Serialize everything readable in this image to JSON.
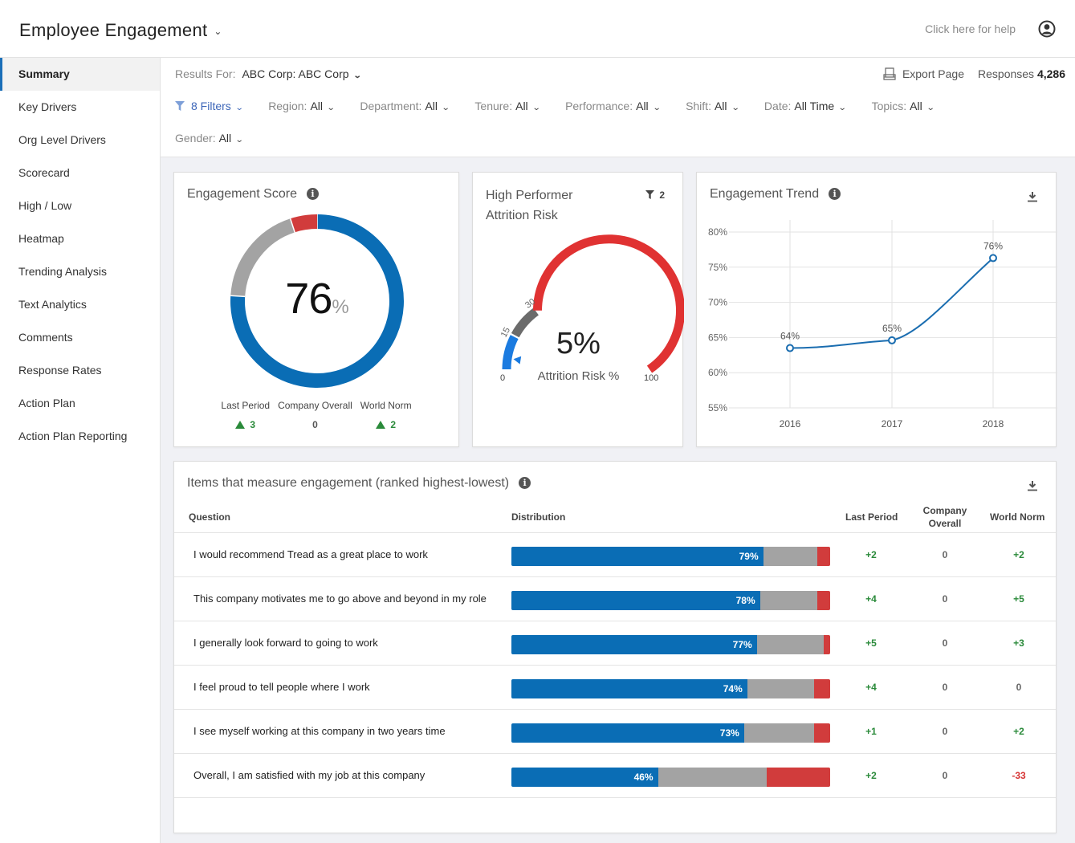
{
  "app": {
    "title": "Employee Engagement",
    "help_link": "Click here for help"
  },
  "sidebar": {
    "items": [
      {
        "label": "Summary",
        "active": true
      },
      {
        "label": "Key Drivers"
      },
      {
        "label": "Org Level Drivers"
      },
      {
        "label": "Scorecard"
      },
      {
        "label": "High / Low"
      },
      {
        "label": "Heatmap"
      },
      {
        "label": "Trending Analysis"
      },
      {
        "label": "Text Analytics"
      },
      {
        "label": "Comments"
      },
      {
        "label": "Response Rates"
      },
      {
        "label": "Action Plan"
      },
      {
        "label": "Action Plan Reporting"
      }
    ]
  },
  "filterbar": {
    "results_for_label": "Results For:",
    "results_for_value": "ABC Corp:  ABC Corp",
    "export_label": "Export Page",
    "responses_label": "Responses",
    "responses_value": "4,286",
    "filters_count_label": "8 Filters",
    "filters": [
      {
        "label": "Region:",
        "value": "All"
      },
      {
        "label": "Department:",
        "value": "All"
      },
      {
        "label": "Tenure:",
        "value": "All"
      },
      {
        "label": "Performance:",
        "value": "All"
      },
      {
        "label": "Shift:",
        "value": "All"
      },
      {
        "label": "Date:",
        "value": "All Time"
      },
      {
        "label": "Topics:",
        "value": "All"
      },
      {
        "label": "Gender:",
        "value": "All"
      }
    ]
  },
  "engagement_score": {
    "title": "Engagement Score",
    "value": "76",
    "unit": "%",
    "donut": {
      "favorable": 76,
      "neutral": 19,
      "unfavorable": 5
    },
    "colors": {
      "favorable": "#0a6db5",
      "neutral": "#a3a3a3",
      "unfavorable": "#d13c3c"
    },
    "stats": [
      {
        "label": "Last Period",
        "value": "3",
        "trend": "up"
      },
      {
        "label": "Company Overall",
        "value": "0",
        "trend": "none"
      },
      {
        "label": "World Norm",
        "value": "2",
        "trend": "up"
      }
    ]
  },
  "attrition": {
    "title_line1": "High Performer",
    "title_line2": "Attrition Risk",
    "filter_count": "2",
    "value": "5%",
    "value_number": 5,
    "label": "Attrition Risk %",
    "scale_min": "0",
    "scale_max": "100",
    "thresholds": [
      "15",
      "30"
    ],
    "bands": [
      {
        "from": 0,
        "to": 15,
        "color": "#1b7be0"
      },
      {
        "from": 15,
        "to": 30,
        "color": "#6b6b6b"
      },
      {
        "from": 30,
        "to": 100,
        "color": "#e03232"
      }
    ]
  },
  "trend": {
    "title": "Engagement Trend"
  },
  "chart_data": {
    "type": "line",
    "title": "Engagement Trend",
    "x": [
      "2016",
      "2017",
      "2018"
    ],
    "series": [
      {
        "name": "Engagement",
        "values": [
          63.5,
          64.6,
          76.3
        ],
        "labels": [
          "64%",
          "65%",
          "76%"
        ]
      }
    ],
    "ylim": [
      55,
      80
    ],
    "yticks": [
      "55%",
      "60%",
      "65%",
      "70%",
      "75%",
      "80%"
    ],
    "ytick_values": [
      55,
      60,
      65,
      70,
      75,
      80
    ],
    "grid": true,
    "color": "#1a6db0"
  },
  "items_table": {
    "title": "Items that measure engagement (ranked highest-lowest)",
    "headers": {
      "question": "Question",
      "distribution": "Distribution",
      "last_period": "Last Period",
      "company_overall_1": "Company",
      "company_overall_2": "Overall",
      "world_norm": "World Norm"
    },
    "rows": [
      {
        "question": "I would recommend Tread as a great place to work",
        "favorable": 79,
        "neutral": 17,
        "unfavorable": 4,
        "fav_label": "79%",
        "last_period": "+2",
        "company_overall": "0",
        "world_norm": "+2"
      },
      {
        "question": "This company motivates me to go above and beyond in my role",
        "favorable": 78,
        "neutral": 18,
        "unfavorable": 4,
        "fav_label": "78%",
        "last_period": "+4",
        "company_overall": "0",
        "world_norm": "+5"
      },
      {
        "question": "I generally look forward to going to work",
        "favorable": 77,
        "neutral": 21,
        "unfavorable": 2,
        "fav_label": "77%",
        "last_period": "+5",
        "company_overall": "0",
        "world_norm": "+3"
      },
      {
        "question": "I feel proud to tell people where I work",
        "favorable": 74,
        "neutral": 21,
        "unfavorable": 5,
        "fav_label": "74%",
        "last_period": "+4",
        "company_overall": "0",
        "world_norm": "0"
      },
      {
        "question": "I see myself working at this company in two years time",
        "favorable": 73,
        "neutral": 22,
        "unfavorable": 5,
        "fav_label": "73%",
        "last_period": "+1",
        "company_overall": "0",
        "world_norm": "+2"
      },
      {
        "question": "Overall, I am satisfied with my job at this company",
        "favorable": 46,
        "neutral": 34,
        "unfavorable": 20,
        "fav_label": "46%",
        "last_period": "+2",
        "company_overall": "0",
        "world_norm": "-33"
      }
    ]
  }
}
